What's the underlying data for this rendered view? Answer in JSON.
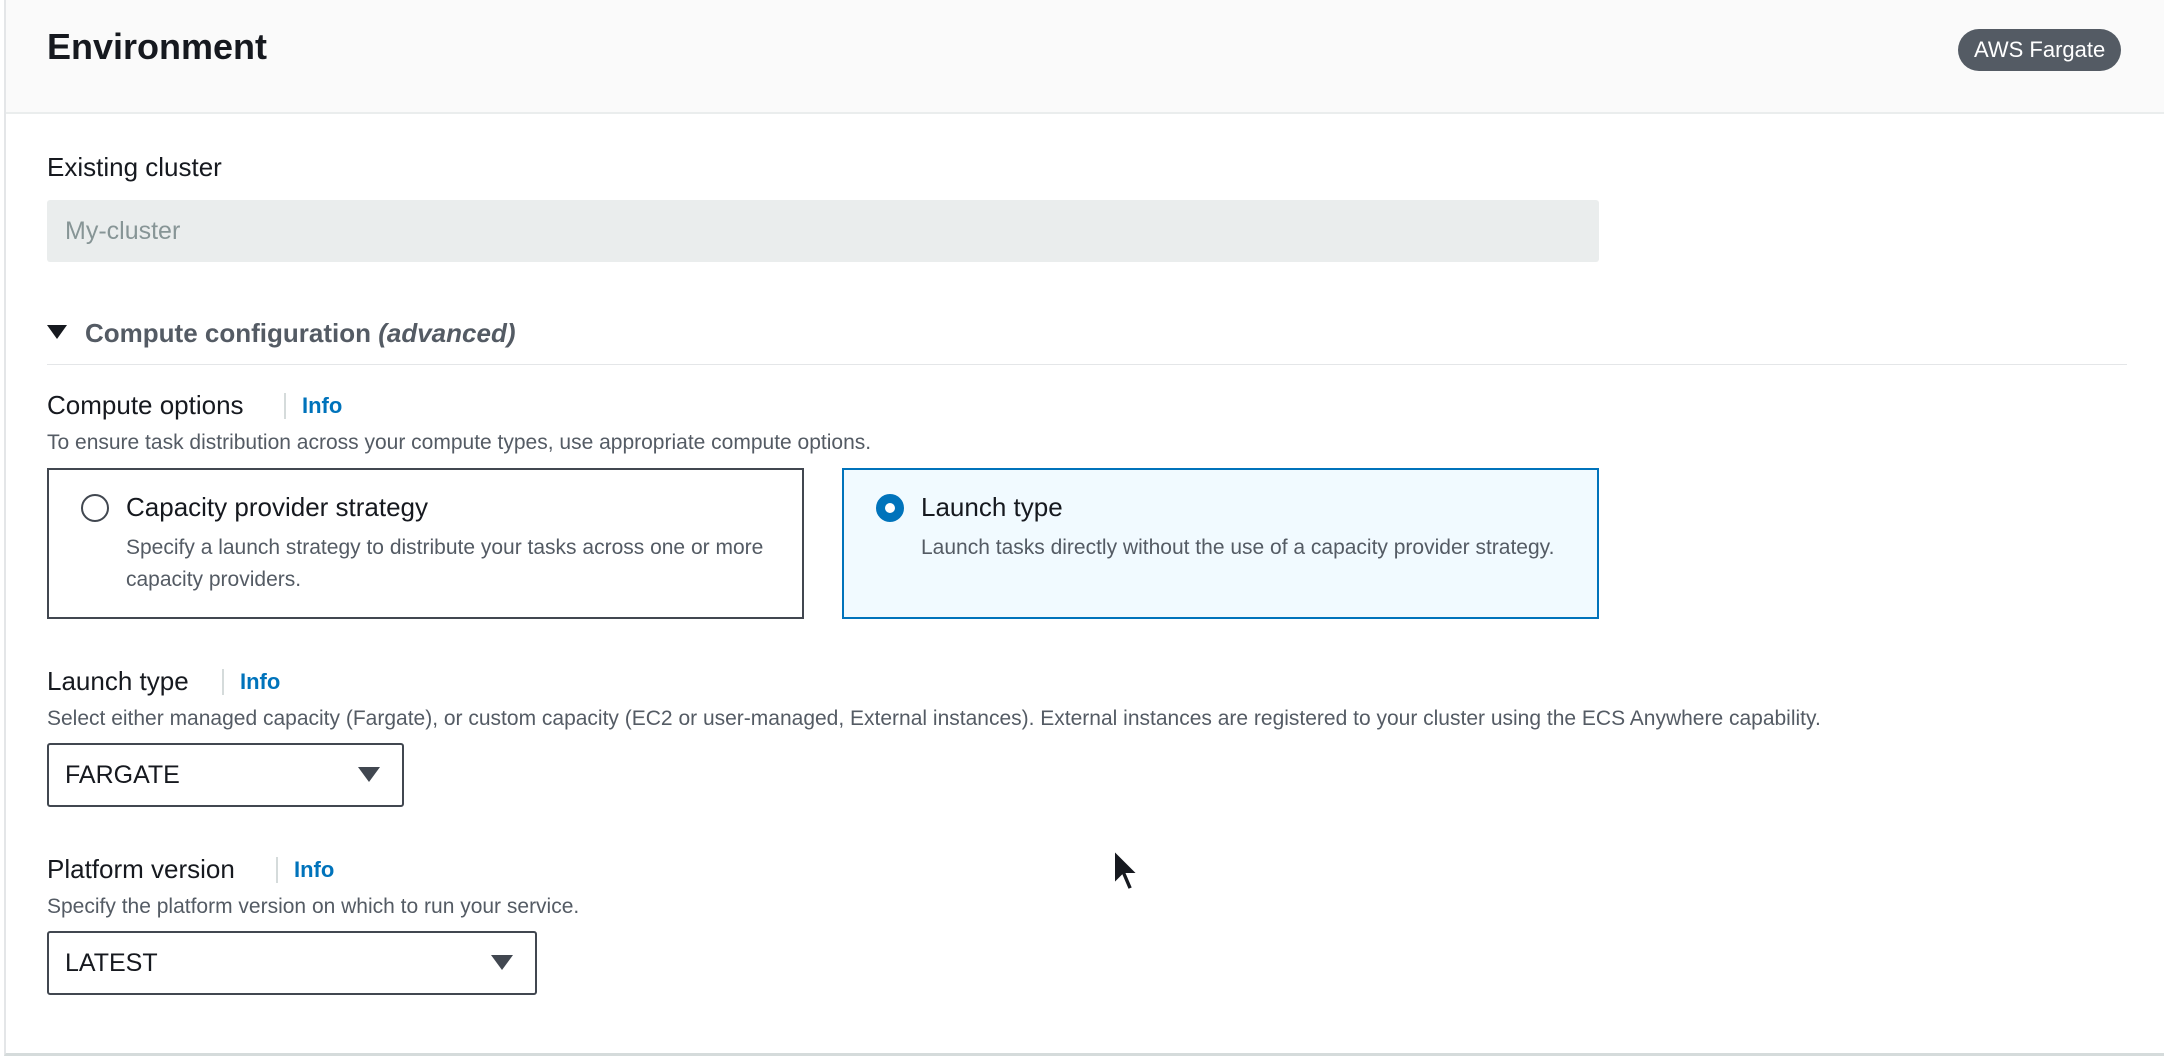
{
  "header": {
    "title": "Environment",
    "badge": "AWS Fargate"
  },
  "existing_cluster": {
    "label": "Existing cluster",
    "value": "My-cluster"
  },
  "compute_configuration": {
    "title": "Compute configuration",
    "title_suffix": "(advanced)",
    "expanded": true
  },
  "compute_options": {
    "label": "Compute options",
    "info": "Info",
    "description": "To ensure task distribution across your compute types, use appropriate compute options.",
    "options": [
      {
        "title": "Capacity provider strategy",
        "description": "Specify a launch strategy to distribute your tasks across one or more capacity providers.",
        "selected": false
      },
      {
        "title": "Launch type",
        "description": "Launch tasks directly without the use of a capacity provider strategy.",
        "selected": true
      }
    ]
  },
  "launch_type": {
    "label": "Launch type",
    "info": "Info",
    "description": "Select either managed capacity (Fargate), or custom capacity (EC2 or user-managed, External instances). External instances are registered to your cluster using the ECS Anywhere capability.",
    "value": "FARGATE"
  },
  "platform_version": {
    "label": "Platform version",
    "info": "Info",
    "description": "Specify the platform version on which to run your service.",
    "value": "LATEST"
  },
  "icons": {
    "caret": "caret-down-icon",
    "dropdown": "chevron-down-icon",
    "cursor": "mouse-pointer-icon"
  },
  "colors": {
    "accent": "#0073bb",
    "badge_bg": "#545b64",
    "selected_tile_bg": "#f1faff"
  }
}
